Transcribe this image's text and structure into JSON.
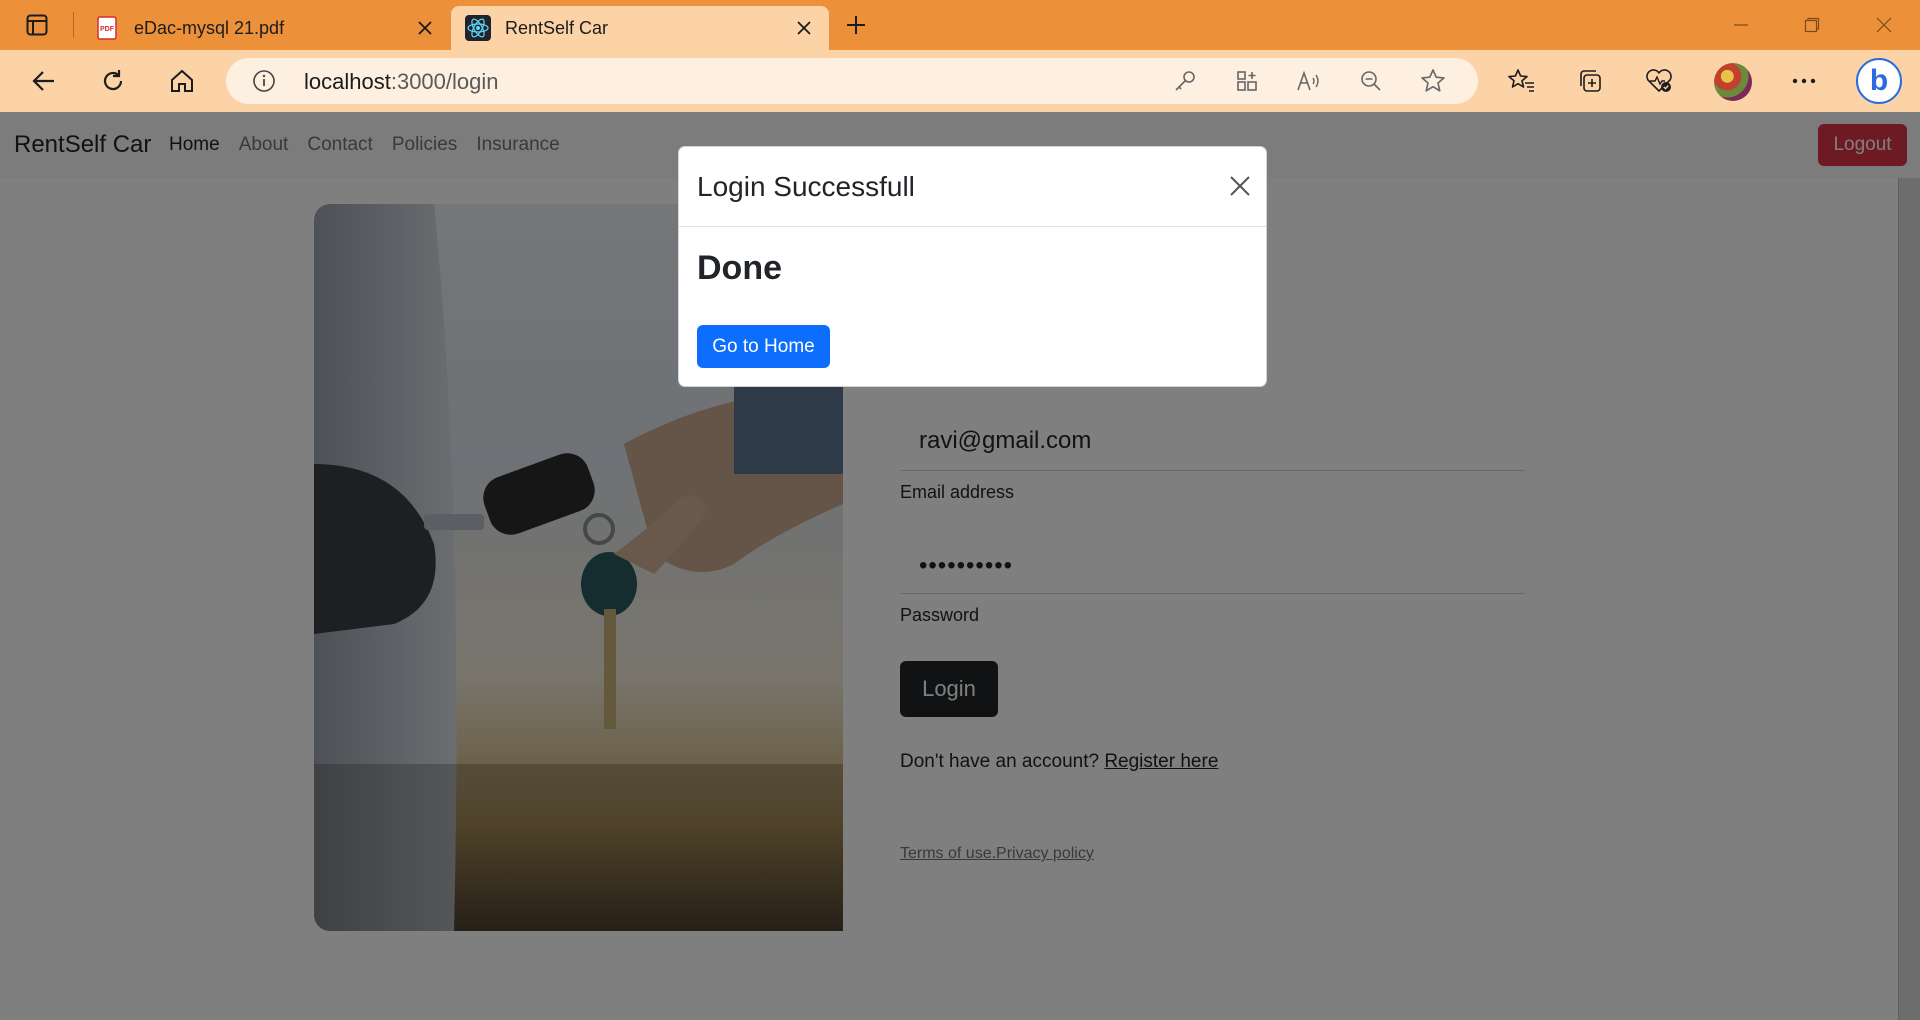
{
  "browser": {
    "tabs": [
      {
        "title": "eDac-mysql 21.pdf",
        "favicon": "pdf-icon",
        "active": false
      },
      {
        "title": "RentSelf Car",
        "favicon": "react-icon",
        "active": true
      }
    ],
    "url_host": "localhost",
    "url_path": ":3000/login",
    "toolbar_icons": [
      "back-icon",
      "refresh-icon",
      "home-icon",
      "key-icon",
      "apps-icon",
      "read-aloud-icon",
      "zoom-out-icon",
      "favorite-star-icon",
      "favorites-icon",
      "collections-icon",
      "browser-essentials-icon",
      "profile-avatar",
      "more-icon",
      "bing-copilot-icon"
    ],
    "bing_label": "b"
  },
  "navbar": {
    "brand": "RentSelf Car",
    "links": [
      "Home",
      "About",
      "Contact",
      "Policies",
      "Insurance"
    ],
    "active_link": "Home",
    "logout_label": "Logout",
    "logout_color": "#dc3545"
  },
  "login_form": {
    "email_value": "ravi@gmail.com",
    "email_label": "Email address",
    "password_value": "••••••••••",
    "password_label": "Password",
    "login_label": "Login",
    "register_prompt": "Don't have an account?",
    "register_link": "Register here",
    "terms_text": "Terms of use.Privacy policy"
  },
  "modal": {
    "title": "Login Successfull",
    "body": "Done",
    "button_label": "Go to Home",
    "button_color": "#0d6efd"
  },
  "colors": {
    "tabbar": "#ec903a",
    "toolbar": "#fbd3a7",
    "backdrop": "rgba(0,0,0,0.5)"
  }
}
